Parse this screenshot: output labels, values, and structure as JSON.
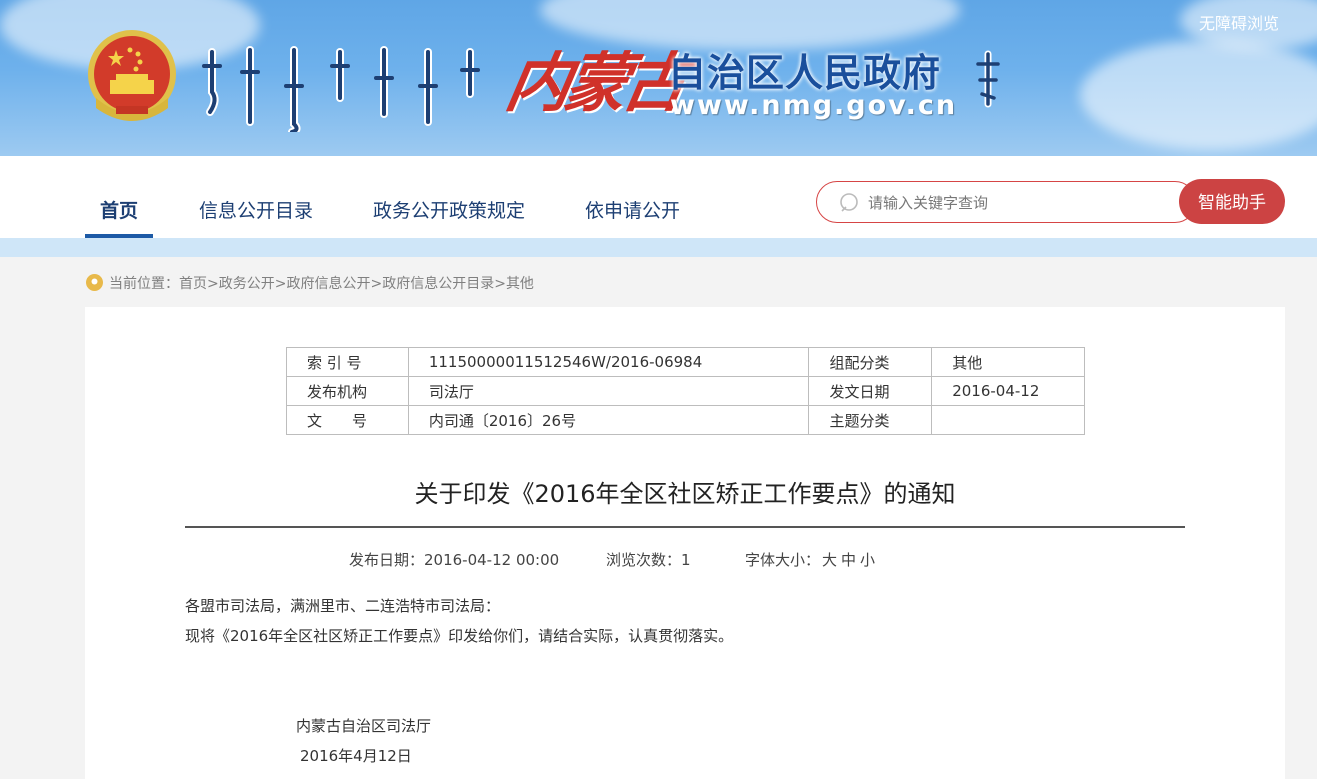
{
  "header": {
    "accessibility_label": "无障碍浏览",
    "logo_calligraphy": "内蒙古",
    "site_title": "自治区人民政府",
    "site_url": "www.nmg.gov.cn",
    "colors": {
      "banner_top": "#5fa6e6",
      "title_blue": "#1a4f9c",
      "logo_red": "#d0312a"
    }
  },
  "nav": {
    "items": [
      {
        "label": "首页",
        "active": true
      },
      {
        "label": "信息公开目录",
        "active": false
      },
      {
        "label": "政务公开政策规定",
        "active": false
      },
      {
        "label": "依申请公开",
        "active": false
      }
    ]
  },
  "search": {
    "placeholder": "请输入关键字查询",
    "button_label": "智能助手",
    "accent": "#cc4343"
  },
  "breadcrumb": {
    "prefix": "当前位置：",
    "items": [
      "首页",
      "政务公开",
      "政府信息公开",
      "政府信息公开目录",
      "其他"
    ],
    "separator": ">"
  },
  "meta_table": {
    "rows": [
      {
        "k1": "索 引 号",
        "v1": "11150000011512546W/2016-06984",
        "k2": "组配分类",
        "v2": "其他"
      },
      {
        "k1": "发布机构",
        "v1": "司法厅",
        "k2": "发文日期",
        "v2": "2016-04-12"
      },
      {
        "k1": "文　　号",
        "v1": "内司通〔2016〕26号",
        "k2": "主题分类",
        "v2": ""
      }
    ]
  },
  "article": {
    "title": "关于印发《2016年全区社区矫正工作要点》的通知",
    "publish_date": "发布日期：2016-04-12 00:00",
    "view_count": "浏览次数：1",
    "font_size_label": "字体大小：",
    "font_sizes": [
      "大",
      "中",
      "小"
    ],
    "paragraphs": [
      "各盟市司法局，满洲里市、二连浩特市司法局：",
      "现将《2016年全区社区矫正工作要点》印发给你们，请结合实际，认真贯彻落实。"
    ],
    "signature": "内蒙古自治区司法厅",
    "sign_date": "2016年4月12日"
  }
}
